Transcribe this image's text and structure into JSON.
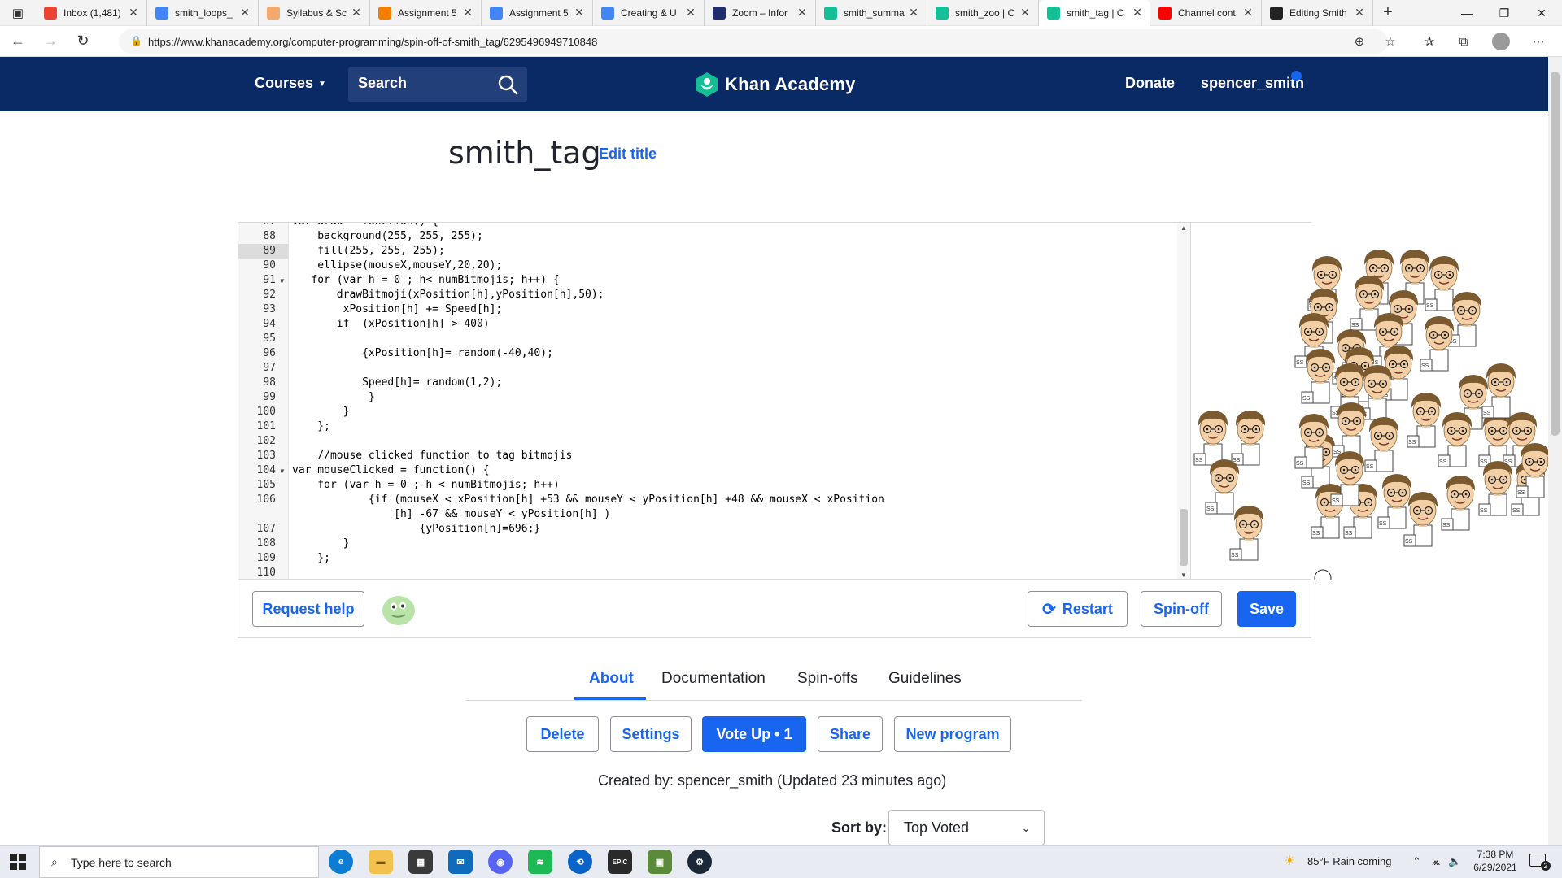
{
  "browser": {
    "tabs": [
      {
        "label": "Inbox (1,481)",
        "icon": "gmail-icon",
        "color": "#ea4335"
      },
      {
        "label": "smith_loops_",
        "icon": "docs-icon",
        "color": "#4285f4"
      },
      {
        "label": "Syllabus & Sc",
        "icon": "blogger-icon",
        "color": "#f2a96b"
      },
      {
        "label": "Assignment 5",
        "icon": "blogger-icon",
        "color": "#f57d00"
      },
      {
        "label": "Assignment 5",
        "icon": "docs-icon",
        "color": "#4285f4"
      },
      {
        "label": "Creating & U",
        "icon": "docs-icon",
        "color": "#4285f4"
      },
      {
        "label": "Zoom – Infor",
        "icon": "r-icon",
        "color": "#1f2d6b"
      },
      {
        "label": "smith_summa",
        "icon": "khan-icon",
        "color": "#14bf96"
      },
      {
        "label": "smith_zoo | C",
        "icon": "khan-icon",
        "color": "#14bf96"
      },
      {
        "label": "smith_tag | C",
        "icon": "khan-icon",
        "color": "#14bf96"
      },
      {
        "label": "Channel cont",
        "icon": "youtube-icon",
        "color": "#ff0000"
      },
      {
        "label": "Editing Smith",
        "icon": "github-icon",
        "color": "#222222"
      }
    ],
    "url": "https://www.khanacademy.org/computer-programming/spin-off-of-smith_tag/6295496949710848"
  },
  "nav": {
    "courses": "Courses",
    "search": "Search",
    "logo": "Khan Academy",
    "donate": "Donate",
    "user": "spencer_smith"
  },
  "program": {
    "title": "smith_tag",
    "edit_title": "Edit title"
  },
  "editor": {
    "top_partial": "var draw = function() {",
    "lines": [
      {
        "n": "88",
        "code": "    background(255, 255, 255);"
      },
      {
        "n": "89",
        "code": "    fill(255, 255, 255);"
      },
      {
        "n": "90",
        "code": "    ellipse(mouseX,mouseY,20,20);"
      },
      {
        "n": "91",
        "code": "   for (var h = 0 ; h< numBitmojis; h++) {",
        "fold": true
      },
      {
        "n": "92",
        "code": "       drawBitmoji(xPosition[h],yPosition[h],50);"
      },
      {
        "n": "93",
        "code": "        xPosition[h] += Speed[h];"
      },
      {
        "n": "94",
        "code": "       if  (xPosition[h] > 400)"
      },
      {
        "n": "95",
        "code": ""
      },
      {
        "n": "96",
        "code": "           {xPosition[h]= random(-40,40);"
      },
      {
        "n": "97",
        "code": ""
      },
      {
        "n": "98",
        "code": "           Speed[h]= random(1,2);"
      },
      {
        "n": "99",
        "code": "            }"
      },
      {
        "n": "100",
        "code": "        }"
      },
      {
        "n": "101",
        "code": "    };"
      },
      {
        "n": "102",
        "code": ""
      },
      {
        "n": "103",
        "code": "    //mouse clicked function to tag bitmojis"
      },
      {
        "n": "104",
        "code": "var mouseClicked = function() {",
        "fold": true
      },
      {
        "n": "105",
        "code": "    for (var h = 0 ; h < numBitmojis; h++)"
      },
      {
        "n": "106",
        "code": "            {if (mouseX < xPosition[h] +53 && mouseY < yPosition[h] +48 && mouseX < xPosition"
      },
      {
        "n": "",
        "code": "                [h] -67 && mouseY < yPosition[h] )"
      },
      {
        "n": "107",
        "code": "                    {yPosition[h]=696;}"
      },
      {
        "n": "108",
        "code": "        }"
      },
      {
        "n": "109",
        "code": "    };"
      },
      {
        "n": "110",
        "code": ""
      }
    ]
  },
  "toolbar": {
    "request_help": "Request help",
    "restart": "Restart",
    "spinoff": "Spin-off",
    "save": "Save"
  },
  "tabs": [
    "About",
    "Documentation",
    "Spin-offs",
    "Guidelines"
  ],
  "actions": {
    "delete": "Delete",
    "settings": "Settings",
    "vote": "Vote Up • 1",
    "share": "Share",
    "new_program": "New program"
  },
  "created_by": "Created by: spencer_smith (Updated 23 minutes ago)",
  "sort": {
    "label": "Sort by:",
    "value": "Top Voted"
  },
  "taskbar": {
    "search_placeholder": "Type here to search",
    "weather": "85°F  Rain coming",
    "time": "7:38 PM",
    "date": "6/29/2021",
    "notif_count": "2"
  },
  "colors": {
    "nav_bg": "#0a2a66",
    "accent": "#1865f2",
    "hair": "#7a5a2e",
    "skin": "#f3cfa6"
  }
}
